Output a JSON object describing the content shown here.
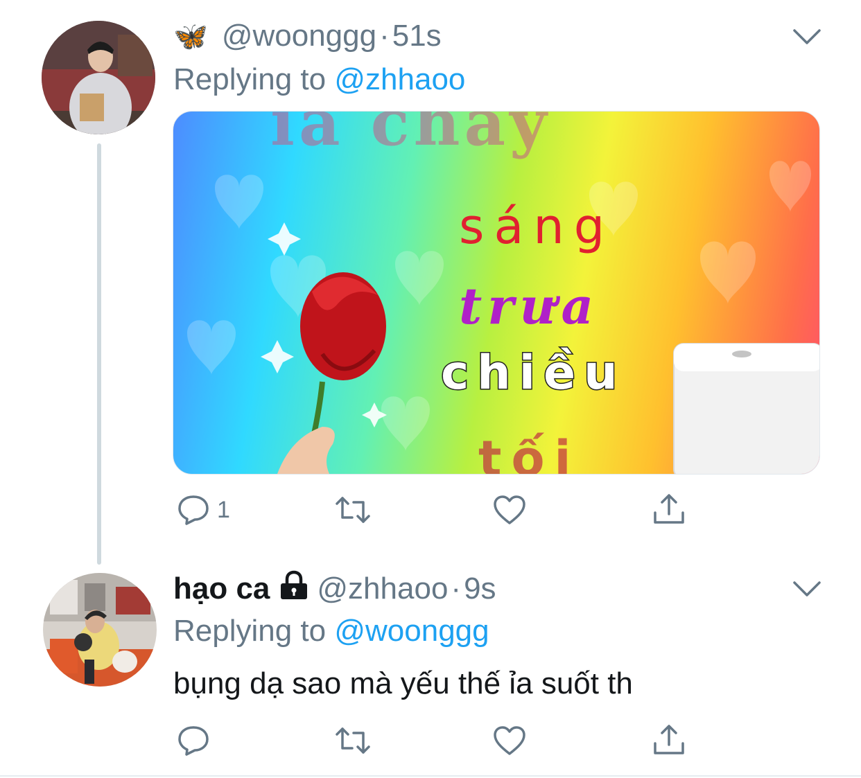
{
  "tweets": [
    {
      "emoji": "🦋",
      "handle": "@woonggg",
      "separator": "·",
      "time": "51s",
      "replying_prefix": "Replying to ",
      "replying_to": "@zhhaoo",
      "media": {
        "text_top": "ỉa chảy",
        "line1": "sáng",
        "line2": "trưa",
        "line3": "chiều",
        "line4": "tối"
      },
      "actions": {
        "reply_count": "1",
        "retweet_count": "",
        "like_count": ""
      }
    },
    {
      "display_name": "hạo ca",
      "handle": "@zhhaoo",
      "separator": "·",
      "time": "9s",
      "replying_prefix": "Replying to ",
      "replying_to": "@woonggg",
      "text": "bụng dạ sao mà yếu thế ỉa suốt th",
      "actions": {
        "reply_count": "",
        "retweet_count": "",
        "like_count": ""
      }
    }
  ],
  "colors": {
    "accent": "#1da1f2",
    "secondary_text": "#657786",
    "primary_text": "#14171a",
    "thread_line": "#cfd9de"
  }
}
